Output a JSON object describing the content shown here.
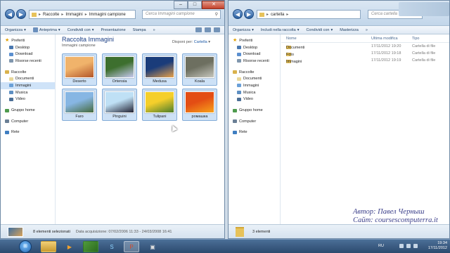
{
  "left_window": {
    "address": [
      "Raccolte",
      "Immagini",
      "Immagini campione"
    ],
    "search_placeholder": "Cerca Immagini campione",
    "toolbar": [
      "Organizza",
      "Anteprima",
      "Condividi con",
      "Presentazione",
      "Stampa",
      "»"
    ],
    "nav": {
      "favorites": "Preferiti",
      "favorites_items": [
        "Desktop",
        "Download",
        "Risorse recenti"
      ],
      "libraries": "Raccolte",
      "libraries_items": [
        "Documenti",
        "Immagini",
        "Musica",
        "Video"
      ],
      "homegroup": "Gruppo home",
      "computer": "Computer",
      "network": "Rete"
    },
    "library_title": "Raccolta Immagini",
    "library_subtitle": "Immagini campione",
    "arrange_label": "Disponi per:",
    "arrange_value": "Cartella",
    "thumbnails": [
      {
        "label": "Deserto",
        "colors": [
          "#f0b36b",
          "#b3562a"
        ]
      },
      {
        "label": "Ortensia",
        "colors": [
          "#3d6f2e",
          "#c7c9f0"
        ]
      },
      {
        "label": "Medusa",
        "colors": [
          "#1a3c7a",
          "#e6a04a"
        ]
      },
      {
        "label": "Koala",
        "colors": [
          "#6d6f60",
          "#c6c6bd"
        ]
      },
      {
        "label": "Faro",
        "colors": [
          "#87b6e3",
          "#456a3d"
        ]
      },
      {
        "label": "Pinguini",
        "colors": [
          "#bfe0f5",
          "#222233"
        ]
      },
      {
        "label": "Tulipani",
        "colors": [
          "#f5cf2b",
          "#4a7d2c"
        ]
      },
      {
        "label": "ромашка",
        "colors": [
          "#e34d14",
          "#f7a21b"
        ]
      }
    ],
    "status_count": "8 elementi selezionati",
    "status_date": "Data acquisizione: 07/02/2006 11:33 - 24/03/2008 16:41"
  },
  "right_window": {
    "address": [
      "cartella",
      "»"
    ],
    "search_placeholder": "Cerca cartella",
    "toolbar": [
      "Organizza",
      "Includi nella raccolta",
      "Condividi con",
      "Masterizza",
      "»"
    ],
    "nav": {
      "favorites": "Preferiti",
      "favorites_items": [
        "Desktop",
        "Download",
        "Risorse recenti"
      ],
      "libraries": "Raccolte",
      "libraries_items": [
        "Documenti",
        "Immagini",
        "Musica",
        "Video"
      ],
      "homegroup": "Gruppo home",
      "computer": "Computer",
      "network": "Rete"
    },
    "columns": [
      "Nome",
      "Ultima modifica",
      "Tipo"
    ],
    "rows": [
      {
        "name": "Documenti",
        "date": "17/11/2012 19:20",
        "type": "Cartella di file"
      },
      {
        "name": "Foto",
        "date": "17/11/2012 19:18",
        "type": "Cartella di file"
      },
      {
        "name": "Immagini",
        "date": "17/11/2012 19:19",
        "type": "Cartella di file"
      }
    ],
    "status_count": "3 elementi"
  },
  "watermark": {
    "line1": "Автор: Павел Черныш",
    "line2": "Сайт: coursescomputerra.it"
  },
  "taskbar": {
    "lang": "RU",
    "time": "19:34",
    "date": "17/11/2012"
  },
  "colors": {
    "accent": "#1b3f85",
    "selection": "#cde1f6"
  }
}
